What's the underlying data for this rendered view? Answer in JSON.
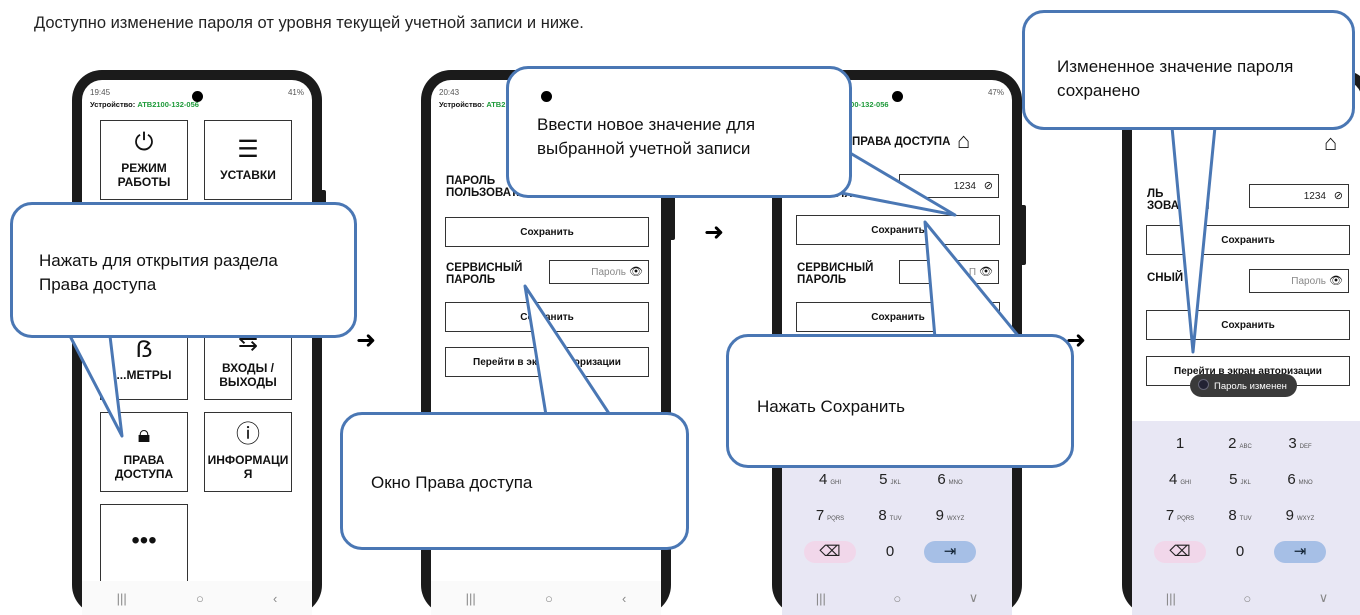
{
  "intro": "Доступно изменение пароля от уровня текущей учетной записи и ниже.",
  "phone1": {
    "time": "19:45",
    "signal": "41%",
    "device_label": "Устройство:",
    "device_id": "ATB2100-132-056",
    "tiles": [
      "РЕЖИМ РАБОТЫ",
      "УСТАВКИ",
      "...МЕТРЫ",
      "ВХОДЫ / ВЫХОДЫ",
      "ПРАВА ДОСТУПА",
      "ИНФОРМАЦИ Я",
      "•••"
    ]
  },
  "phone2": {
    "time": "20:43",
    "device_id": "ATB2",
    "title": "П",
    "user_label": "ПАРОЛЬ ПОЛЬЗОВАТ...",
    "save": "Сохранить",
    "service_label": "СЕРВИСНЫЙ ПАРОЛЬ",
    "placeholder": "Пароль",
    "save2": "Сохранить",
    "auth": "Перейти в экран авторизации"
  },
  "phone3": {
    "device_id": "100-132-056",
    "signal": "47%",
    "title": "ПРАВА ДОСТУПА",
    "user_label": "...ЗАТЕЛЯ",
    "user_value": "1234",
    "save": "Сохранить",
    "service_label": "СЕРВИСНЫЙ ПАРОЛЬ",
    "placeholder": "П",
    "save2": "Сохранить"
  },
  "phone4": {
    "user_label": "ЛЬ ЗОВАТЕЛЯ",
    "user_value": "1234",
    "save": "Сохранить",
    "service_label": "СНЫЙ",
    "placeholder": "Пароль",
    "save2": "Сохранить",
    "auth": "Перейти в экран авторизации",
    "toast": "Пароль изменен"
  },
  "keypad": {
    "keys": [
      "1",
      "2",
      "3",
      "4",
      "5",
      "6",
      "7",
      "8",
      "9",
      "⌫",
      "0",
      "⇥"
    ],
    "subs": [
      "",
      "ABC",
      "DEF",
      "GHI",
      "JKL",
      "MNO",
      "PQRS",
      "TUV",
      "WXYZ",
      "",
      "",
      ""
    ]
  },
  "callouts": {
    "c1": "Нажать для открытия раздела Права доступа",
    "c2": "Ввести новое значение для выбранной учетной записи",
    "c3": "Окно Права доступа",
    "c4": "Нажать Сохранить",
    "c5": "Измененное значение пароля сохранено"
  },
  "colors": {
    "callout_border": "#4a77b4",
    "device_green": "#1e9a3a",
    "keypad_bg": "#e8e7f4"
  },
  "icons": [
    "power-icon",
    "list-icon",
    "arrows-icon",
    "lock-icon",
    "info-icon",
    "home-icon",
    "eye-icon",
    "eye-off-icon"
  ]
}
